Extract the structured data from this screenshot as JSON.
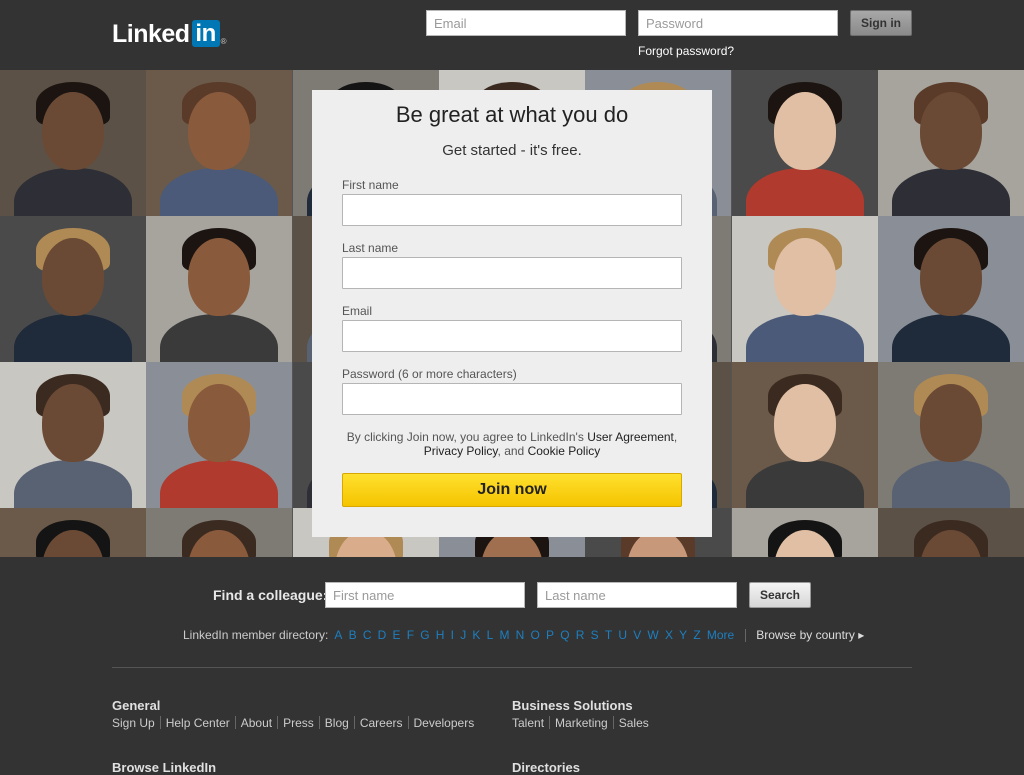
{
  "header": {
    "logo_text": "Linked",
    "logo_box": "in",
    "logo_reg": "®",
    "email_placeholder": "Email",
    "password_placeholder": "Password",
    "sign_in_label": "Sign in",
    "forgot_password": "Forgot password?"
  },
  "signup": {
    "title": "Be great at what you do",
    "subtitle": "Get started - it's free.",
    "fields": [
      {
        "label": "First name"
      },
      {
        "label": "Last name"
      },
      {
        "label": "Email"
      },
      {
        "label": "Password (6 or more characters)"
      }
    ],
    "terms_prefix": "By clicking Join now, you agree to LinkedIn's ",
    "user_agreement": "User Agreement",
    "comma": ",",
    "privacy_policy": "Privacy Policy",
    "and_text": ", and ",
    "cookie_policy": "Cookie Policy",
    "join_label": "Join now"
  },
  "find_colleague": {
    "label": "Find a colleague:",
    "first_placeholder": "First name",
    "last_placeholder": "Last name",
    "search_label": "Search"
  },
  "directory": {
    "label": "LinkedIn member directory:",
    "letters": [
      "A",
      "B",
      "C",
      "D",
      "E",
      "F",
      "G",
      "H",
      "I",
      "J",
      "K",
      "L",
      "M",
      "N",
      "O",
      "P",
      "Q",
      "R",
      "S",
      "T",
      "U",
      "V",
      "W",
      "X",
      "Y",
      "Z"
    ],
    "more": "More",
    "browse": "Browse by country ▸"
  },
  "footer": {
    "general_title": "General",
    "general_links": [
      "Sign Up",
      "Help Center",
      "About",
      "Press",
      "Blog",
      "Careers",
      "Developers"
    ],
    "business_title": "Business Solutions",
    "business_links": [
      "Talent",
      "Marketing",
      "Sales"
    ],
    "browse_title": "Browse LinkedIn",
    "directories_title": "Directories"
  },
  "colors": {
    "background": "#333333",
    "brand_blue": "#0077b5",
    "join_yellow": "#f5c400",
    "link_blue": "#1d7fc0"
  }
}
